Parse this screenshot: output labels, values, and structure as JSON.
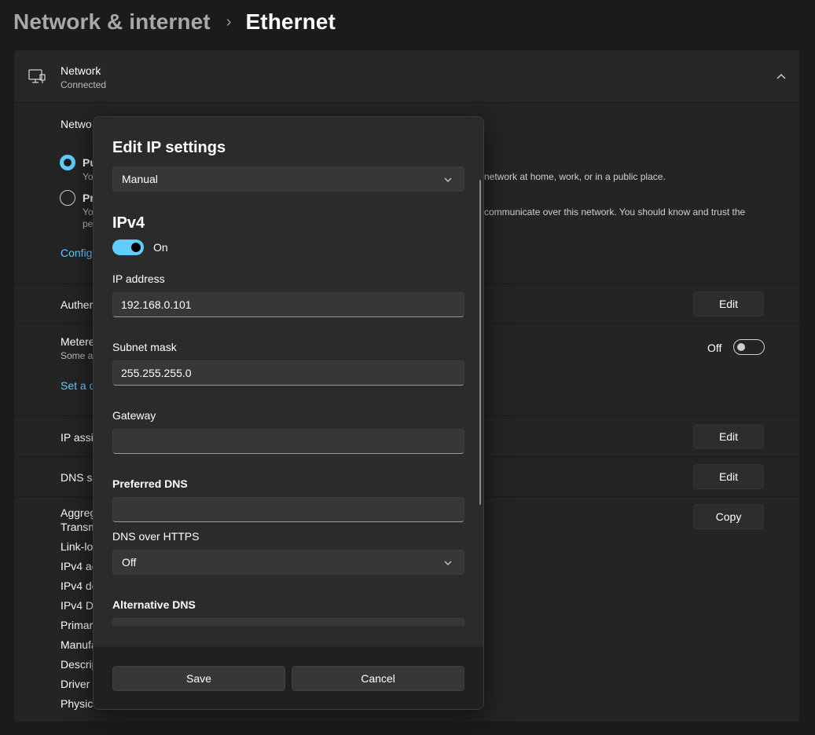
{
  "breadcrumb": {
    "parent": "Network & internet",
    "separator": "›",
    "current": "Ethernet"
  },
  "network_card": {
    "icon": "ethernet-monitor-icon",
    "title": "Network",
    "status": "Connected"
  },
  "background": {
    "profile_heading": "Netwo",
    "public_label": "Pu",
    "public_desc_start": "Yo",
    "public_desc_end": "network at home, work, or in a public place.",
    "private_label": "Pr",
    "private_desc_start": "Yo",
    "private_desc_end": "communicate over this network. You should know and trust the",
    "private_desc_line2": "pe",
    "configure_link": "Config",
    "auth_label": "Auther",
    "metered_label": "Metere",
    "metered_desc": "Some ap",
    "metered_state": "Off",
    "data_limit_link": "Set a d",
    "ip_assign_label": "IP assig",
    "dns_label": "DNS se",
    "edit_label": "Edit",
    "copy_label": "Copy",
    "properties": [
      "Aggreg",
      "Transm",
      "Link-lo",
      "IPv4 ac",
      "IPv4 de",
      "IPv4 DI",
      "Primary",
      "Manufa",
      "Descrip",
      "Driver v",
      "Physica"
    ]
  },
  "dialog": {
    "title": "Edit IP settings",
    "mode": "Manual",
    "section": "IPv4",
    "toggle_state": "On",
    "ip_label": "IP address",
    "ip_value": "192.168.0.101",
    "subnet_label": "Subnet mask",
    "subnet_value": "255.255.255.0",
    "gateway_label": "Gateway",
    "gateway_value": "",
    "pref_dns_label": "Preferred DNS",
    "pref_dns_value": "",
    "doh_label": "DNS over HTTPS",
    "doh_value": "Off",
    "alt_dns_label": "Alternative DNS",
    "save": "Save",
    "cancel": "Cancel"
  },
  "colors": {
    "accent": "#60cdff",
    "background": "#1b1b1b",
    "dialog": "#2b2b2b"
  }
}
